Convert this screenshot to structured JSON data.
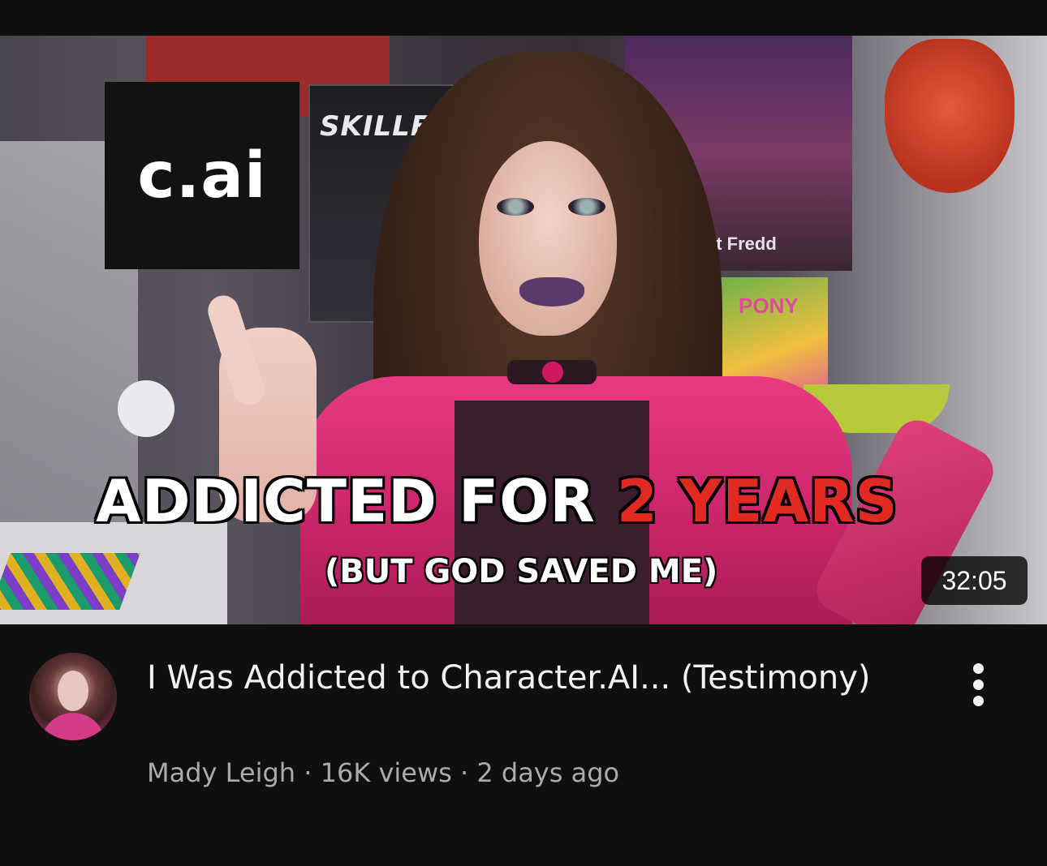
{
  "thumbnail": {
    "logo_text": "c.ai",
    "poster_text_1": "SKILLET",
    "poster_text_2": "at Fredd",
    "poster_text_3": "PONY",
    "headline_white": "ADDICTED FOR ",
    "headline_red": "2 YEARS",
    "subheadline": "(BUT GOD SAVED ME)",
    "duration": "32:05"
  },
  "video": {
    "title": "I Was Addicted to Character.AI... (Testimony)",
    "channel": "Mady Leigh",
    "separator": " · ",
    "views": "16K views",
    "age": "2 days ago"
  },
  "icons": {
    "more": "more-vert-icon"
  },
  "colors": {
    "background": "#0f0f0f",
    "title": "#f1f1f1",
    "meta": "#aaaaaa",
    "headline_red": "#e02a22"
  }
}
